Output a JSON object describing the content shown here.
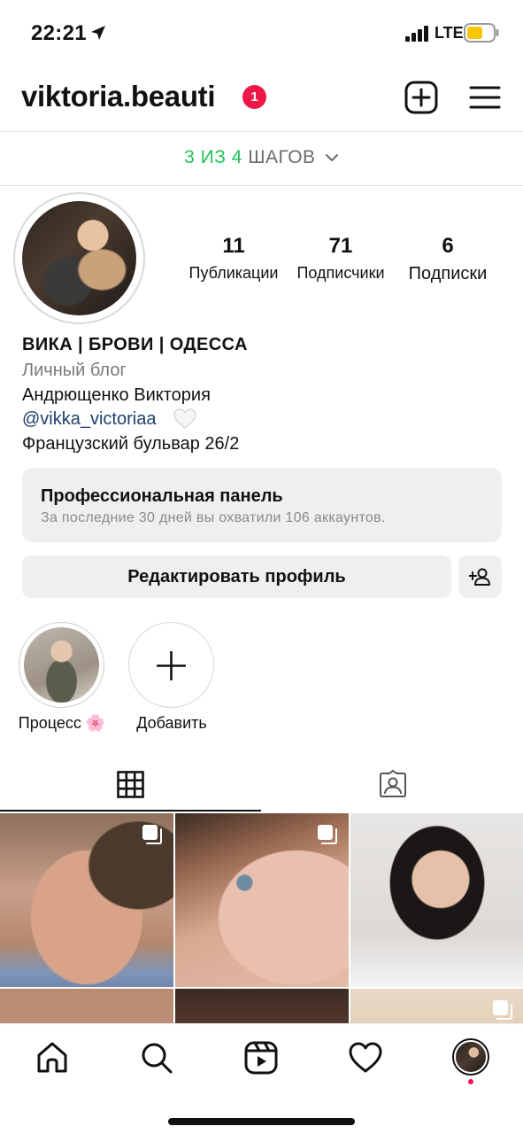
{
  "status_bar": {
    "time": "22:21",
    "network": "LTE"
  },
  "header": {
    "username": "viktoria.beauti",
    "notification_count": "1"
  },
  "steps": {
    "progress": "3 ИЗ 4",
    "label": "ШАГОВ"
  },
  "stats": [
    {
      "value": "11",
      "label": "Публикации"
    },
    {
      "value": "71",
      "label": "Подписчики"
    },
    {
      "value": "6",
      "label": "Подписки"
    }
  ],
  "bio": {
    "name": "ВИКА | БРОВИ | ОДЕССА",
    "category": "Личный блог",
    "full_name": "Андрющенко Виктория",
    "link": "@vikka_victoriaa",
    "address": "Французский бульвар 26/2"
  },
  "pro_panel": {
    "title": "Профессиональная панель",
    "subtitle": "За последние 30 дней вы охватили 106 аккаунтов."
  },
  "buttons": {
    "edit_profile": "Редактировать профиль"
  },
  "highlights": [
    {
      "label": "Процесс 🌸"
    },
    {
      "label": "Добавить"
    }
  ],
  "colors": {
    "accent_green": "#21c25b",
    "badge_red": "#ed1848",
    "link_blue": "#1d3f6e",
    "panel_gray": "#efefef"
  },
  "icons": [
    "location-arrow-icon",
    "signal-icon",
    "battery-icon",
    "add-post-icon",
    "menu-icon",
    "chevron-down-icon",
    "heart-icon",
    "add-person-icon",
    "plus-icon",
    "grid-icon",
    "tagged-icon",
    "multiple-posts-icon",
    "home-icon",
    "search-icon",
    "reels-icon",
    "activity-heart-icon"
  ]
}
